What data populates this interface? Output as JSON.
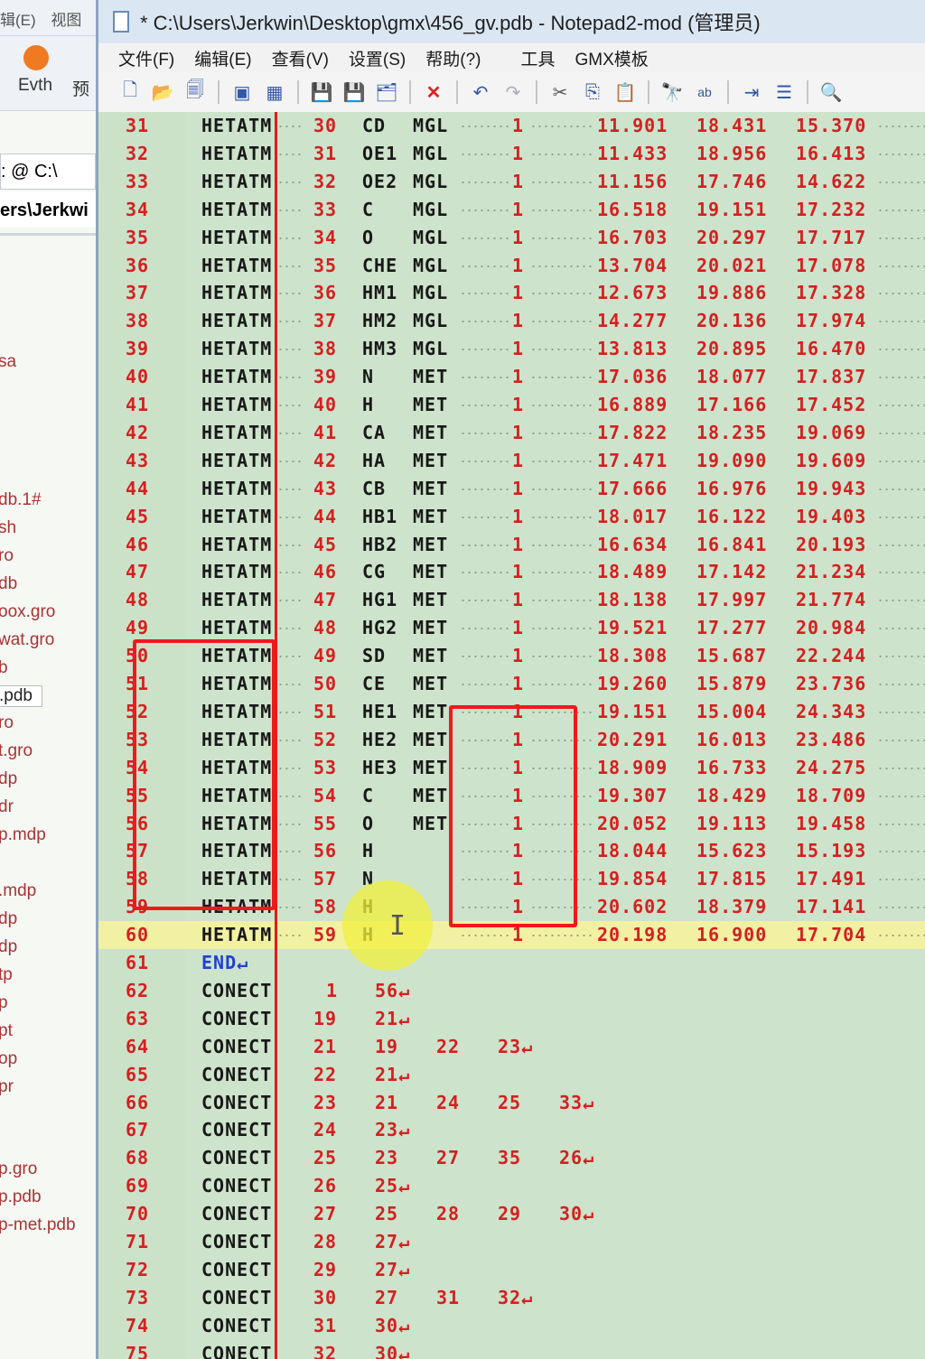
{
  "bg_window": {
    "menu": [
      "辑(E)",
      "视图"
    ],
    "toolbar_label": "Evth",
    "toolbar_label2": "预",
    "address": ": @ C:\\",
    "path": "ers\\Jerkwi",
    "files": [
      "sa",
      "db.1#",
      "sh",
      "ro",
      "db",
      "oox.gro",
      "wat.gro",
      "b",
      ".pdb",
      "ro",
      "t.gro",
      "dp",
      "dr",
      "p.mdp",
      "",
      ".mdp",
      "dp",
      "dp",
      "tp",
      "p",
      "pt",
      "op",
      "pr",
      "p.gro",
      "p.pdb",
      "p-met.pdb"
    ]
  },
  "window": {
    "title": "* C:\\Users\\Jerkwin\\Desktop\\gmx\\456_gv.pdb - Notepad2-mod (管理员)"
  },
  "menu": [
    "文件(F)",
    "编辑(E)",
    "查看(V)",
    "设置(S)",
    "帮助(?)",
    "工具",
    "GMX模板"
  ],
  "toolbar": [
    "new-icon",
    "open-icon",
    "browse-icon",
    "save-copy-icon",
    "templates-icon",
    "save-icon",
    "save-as-icon",
    "save-all-icon",
    "close-icon",
    "undo-icon",
    "redo-icon",
    "cut-icon",
    "copy-icon",
    "paste-icon",
    "find-icon",
    "replace-icon",
    "wrap-icon",
    "list-icon",
    "zoom-icon"
  ],
  "atoms": [
    {
      "line": "31",
      "serial": "30",
      "name": "CD",
      "res": "MGL",
      "seq": "1",
      "x": "11.901",
      "y": "18.431",
      "z": "15.370"
    },
    {
      "line": "32",
      "serial": "31",
      "name": "OE1",
      "res": "MGL",
      "seq": "1",
      "x": "11.433",
      "y": "18.956",
      "z": "16.413"
    },
    {
      "line": "33",
      "serial": "32",
      "name": "OE2",
      "res": "MGL",
      "seq": "1",
      "x": "11.156",
      "y": "17.746",
      "z": "14.622"
    },
    {
      "line": "34",
      "serial": "33",
      "name": "C",
      "res": "MGL",
      "seq": "1",
      "x": "16.518",
      "y": "19.151",
      "z": "17.232"
    },
    {
      "line": "35",
      "serial": "34",
      "name": "O",
      "res": "MGL",
      "seq": "1",
      "x": "16.703",
      "y": "20.297",
      "z": "17.717"
    },
    {
      "line": "36",
      "serial": "35",
      "name": "CHE",
      "res": "MGL",
      "seq": "1",
      "x": "13.704",
      "y": "20.021",
      "z": "17.078"
    },
    {
      "line": "37",
      "serial": "36",
      "name": "HM1",
      "res": "MGL",
      "seq": "1",
      "x": "12.673",
      "y": "19.886",
      "z": "17.328"
    },
    {
      "line": "38",
      "serial": "37",
      "name": "HM2",
      "res": "MGL",
      "seq": "1",
      "x": "14.277",
      "y": "20.136",
      "z": "17.974"
    },
    {
      "line": "39",
      "serial": "38",
      "name": "HM3",
      "res": "MGL",
      "seq": "1",
      "x": "13.813",
      "y": "20.895",
      "z": "16.470"
    },
    {
      "line": "40",
      "serial": "39",
      "name": "N",
      "res": "MET",
      "seq": "1",
      "x": "17.036",
      "y": "18.077",
      "z": "17.837"
    },
    {
      "line": "41",
      "serial": "40",
      "name": "H",
      "res": "MET",
      "seq": "1",
      "x": "16.889",
      "y": "17.166",
      "z": "17.452"
    },
    {
      "line": "42",
      "serial": "41",
      "name": "CA",
      "res": "MET",
      "seq": "1",
      "x": "17.822",
      "y": "18.235",
      "z": "19.069"
    },
    {
      "line": "43",
      "serial": "42",
      "name": "HA",
      "res": "MET",
      "seq": "1",
      "x": "17.471",
      "y": "19.090",
      "z": "19.609"
    },
    {
      "line": "44",
      "serial": "43",
      "name": "CB",
      "res": "MET",
      "seq": "1",
      "x": "17.666",
      "y": "16.976",
      "z": "19.943"
    },
    {
      "line": "45",
      "serial": "44",
      "name": "HB1",
      "res": "MET",
      "seq": "1",
      "x": "18.017",
      "y": "16.122",
      "z": "19.403"
    },
    {
      "line": "46",
      "serial": "45",
      "name": "HB2",
      "res": "MET",
      "seq": "1",
      "x": "16.634",
      "y": "16.841",
      "z": "20.193"
    },
    {
      "line": "47",
      "serial": "46",
      "name": "CG",
      "res": "MET",
      "seq": "1",
      "x": "18.489",
      "y": "17.142",
      "z": "21.234"
    },
    {
      "line": "48",
      "serial": "47",
      "name": "HG1",
      "res": "MET",
      "seq": "1",
      "x": "18.138",
      "y": "17.997",
      "z": "21.774"
    },
    {
      "line": "49",
      "serial": "48",
      "name": "HG2",
      "res": "MET",
      "seq": "1",
      "x": "19.521",
      "y": "17.277",
      "z": "20.984"
    },
    {
      "line": "50",
      "serial": "49",
      "name": "SD",
      "res": "MET",
      "seq": "1",
      "x": "18.308",
      "y": "15.687",
      "z": "22.244"
    },
    {
      "line": "51",
      "serial": "50",
      "name": "CE",
      "res": "MET",
      "seq": "1",
      "x": "19.260",
      "y": "15.879",
      "z": "23.736"
    },
    {
      "line": "52",
      "serial": "51",
      "name": "HE1",
      "res": "MET",
      "seq": "1",
      "x": "19.151",
      "y": "15.004",
      "z": "24.343"
    },
    {
      "line": "53",
      "serial": "52",
      "name": "HE2",
      "res": "MET",
      "seq": "1",
      "x": "20.291",
      "y": "16.013",
      "z": "23.486"
    },
    {
      "line": "54",
      "serial": "53",
      "name": "HE3",
      "res": "MET",
      "seq": "1",
      "x": "18.909",
      "y": "16.733",
      "z": "24.275"
    },
    {
      "line": "55",
      "serial": "54",
      "name": "C",
      "res": "MET",
      "seq": "1",
      "x": "19.307",
      "y": "18.429",
      "z": "18.709"
    },
    {
      "line": "56",
      "serial": "55",
      "name": "O",
      "res": "MET",
      "seq": "1",
      "x": "20.052",
      "y": "19.113",
      "z": "19.458"
    },
    {
      "line": "57",
      "serial": "56",
      "name": "H",
      "res": "",
      "seq": "1",
      "x": "18.044",
      "y": "15.623",
      "z": "15.193"
    },
    {
      "line": "58",
      "serial": "57",
      "name": "N",
      "res": "",
      "seq": "1",
      "x": "19.854",
      "y": "17.815",
      "z": "17.491"
    },
    {
      "line": "59",
      "serial": "58",
      "name": "H",
      "res": "",
      "seq": "1",
      "x": "20.602",
      "y": "18.379",
      "z": "17.141"
    },
    {
      "line": "60",
      "serial": "59",
      "name": "H",
      "res": "",
      "seq": "1",
      "x": "20.198",
      "y": "16.900",
      "z": "17.704"
    }
  ],
  "record_label": "HETATM",
  "end_line": {
    "line": "61",
    "text": "END"
  },
  "conects": [
    {
      "line": "62",
      "vals": [
        "1",
        "56"
      ]
    },
    {
      "line": "63",
      "vals": [
        "19",
        "21"
      ]
    },
    {
      "line": "64",
      "vals": [
        "21",
        "19",
        "22",
        "23"
      ]
    },
    {
      "line": "65",
      "vals": [
        "22",
        "21"
      ]
    },
    {
      "line": "66",
      "vals": [
        "23",
        "21",
        "24",
        "25",
        "33"
      ]
    },
    {
      "line": "67",
      "vals": [
        "24",
        "23"
      ]
    },
    {
      "line": "68",
      "vals": [
        "25",
        "23",
        "27",
        "35",
        "26"
      ]
    },
    {
      "line": "69",
      "vals": [
        "26",
        "25"
      ]
    },
    {
      "line": "70",
      "vals": [
        "27",
        "25",
        "28",
        "29",
        "30"
      ]
    },
    {
      "line": "71",
      "vals": [
        "28",
        "27"
      ]
    },
    {
      "line": "72",
      "vals": [
        "29",
        "27"
      ]
    },
    {
      "line": "73",
      "vals": [
        "30",
        "27",
        "31",
        "32"
      ]
    },
    {
      "line": "74",
      "vals": [
        "31",
        "30"
      ]
    },
    {
      "line": "75",
      "vals": [
        "32",
        "30"
      ]
    }
  ],
  "conect_label": "CONECT",
  "current_line": "60"
}
